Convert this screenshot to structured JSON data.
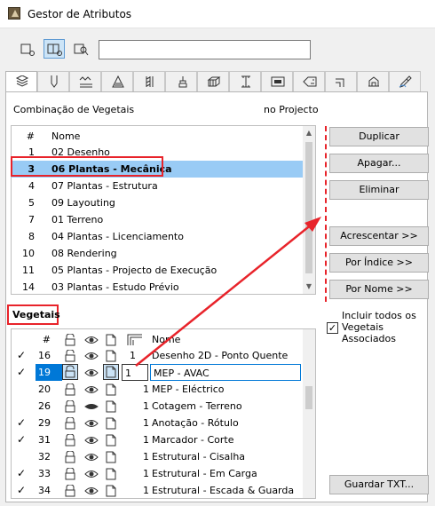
{
  "window": {
    "title": "Gestor de Atributos"
  },
  "toolbar": {
    "search_value": ""
  },
  "combo": {
    "label": "Combinação de Vegetais",
    "project_label": "no Projecto",
    "columns": {
      "num": "#",
      "name": "Nome"
    },
    "rows": [
      {
        "num": "1",
        "name": "02 Desenho"
      },
      {
        "num": "3",
        "name": "06 Plantas - Mecânica"
      },
      {
        "num": "4",
        "name": "07 Plantas - Estrutura"
      },
      {
        "num": "5",
        "name": "09 Layouting"
      },
      {
        "num": "7",
        "name": "01 Terreno"
      },
      {
        "num": "8",
        "name": "04 Plantas - Licenciamento"
      },
      {
        "num": "10",
        "name": "08 Rendering"
      },
      {
        "num": "11",
        "name": "05 Plantas - Projecto de Execução"
      },
      {
        "num": "14",
        "name": "03 Plantas - Estudo Prévio"
      }
    ]
  },
  "buttons": {
    "duplicar": "Duplicar",
    "apagar": "Apagar...",
    "eliminar": "Eliminar",
    "acrescentar": "Acrescentar >>",
    "por_indice": "Por Índice >>",
    "por_nome": "Por Nome >>",
    "guardar_txt": "Guardar TXT..."
  },
  "vegetais": {
    "label": "Vegetais",
    "include_label_1": "Incluir todos os",
    "include_label_2": "Vegetais",
    "include_label_3": "Associados",
    "include_checked": "✓",
    "columns": {
      "num": "#",
      "name": "Nome"
    },
    "rows": [
      {
        "check": "✓",
        "num": "16",
        "pen": "1",
        "name": "Desenho 2D - Ponto Quente"
      },
      {
        "check": "✓",
        "num": "19",
        "pen": "1",
        "name": "MEP - AVAC"
      },
      {
        "check": "",
        "num": "20",
        "pen": "1",
        "name": "MEP - Eléctrico"
      },
      {
        "check": "",
        "num": "26",
        "pen": "1",
        "name": "Cotagem - Terreno"
      },
      {
        "check": "✓",
        "num": "29",
        "pen": "1",
        "name": "Anotação - Rótulo"
      },
      {
        "check": "✓",
        "num": "31",
        "pen": "1",
        "name": "Marcador - Corte"
      },
      {
        "check": "",
        "num": "32",
        "pen": "1",
        "name": "Estrutural - Cisalha"
      },
      {
        "check": "✓",
        "num": "33",
        "pen": "1",
        "name": "Estrutural - Em Carga"
      },
      {
        "check": "✓",
        "num": "34",
        "pen": "1",
        "name": "Estrutural - Escada & Guarda"
      }
    ]
  },
  "colors": {
    "accent": "#e8232a",
    "selection": "#99cbf5",
    "edit_selection": "#0078d7"
  }
}
